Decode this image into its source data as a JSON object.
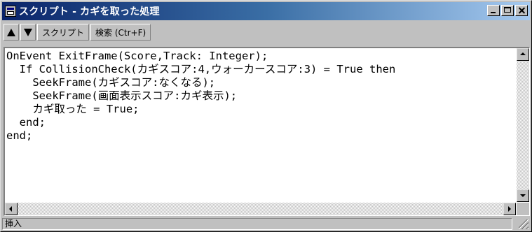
{
  "window": {
    "title": "スクリプト - カギを取った処理"
  },
  "toolbar": {
    "up_icon": "triangle-up-icon",
    "down_icon": "triangle-down-icon",
    "script_label": "スクリプト",
    "search_label": "検索 (Ctr+F)"
  },
  "editor": {
    "lines": [
      "OnEvent ExitFrame(Score,Track: Integer);",
      "  If CollisionCheck(カギスコア:4,ウォーカースコア:3) = True then",
      "    SeekFrame(カギスコア:なくなる);",
      "    SeekFrame(画面表示スコア:カギ表示);",
      "    カギ取った = True;",
      "  end;",
      "end;"
    ]
  },
  "status": {
    "mode": "挿入"
  },
  "colors": {
    "titlebar_start": "#0a246a",
    "titlebar_end": "#a6caf0",
    "face": "#c0c0c0"
  }
}
